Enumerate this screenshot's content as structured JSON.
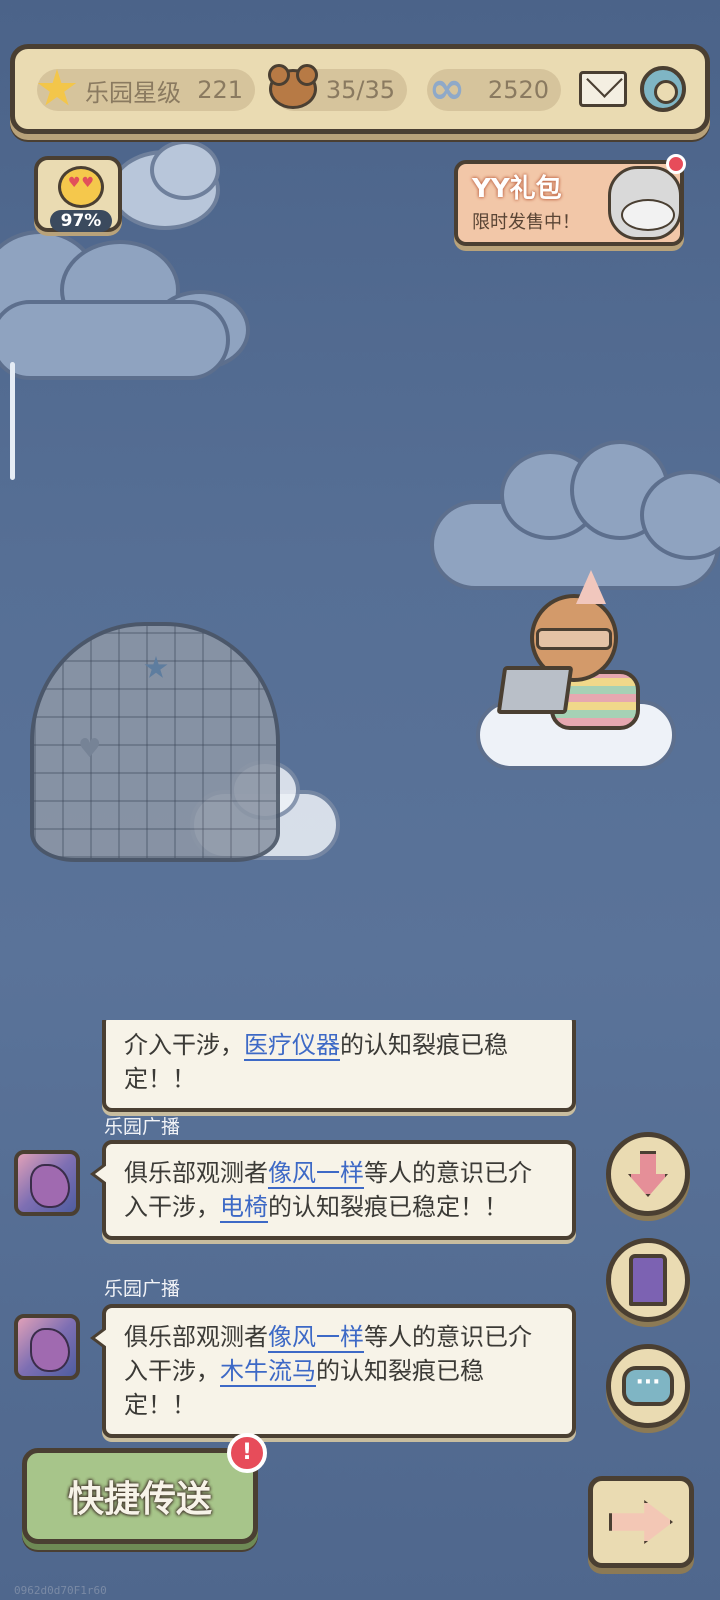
{
  "top_bar": {
    "park_level_label": "乐园星级",
    "park_level_value": "221",
    "bear_count": "35/35",
    "infinity_value": "2520",
    "icons": [
      "star-icon",
      "bear-icon",
      "infinity-icon",
      "mail-icon",
      "gear-icon"
    ]
  },
  "mood": {
    "value": "97%",
    "icon": "heart-eyes-face-icon"
  },
  "gift": {
    "title": "YY礼包",
    "subtitle": "限时发售中！",
    "has_notification": true
  },
  "chat": {
    "messages": [
      {
        "sender": "",
        "text_before": "介入干涉，",
        "link": "医疗仪器",
        "text_after": "的认知裂痕已稳定！！"
      },
      {
        "sender": "乐园广播",
        "text_before": "俱乐部观测者",
        "link": "像风一样",
        "text_middle": "等人的意识已介入干涉，",
        "link2": "电椅",
        "text_after": "的认知裂痕已稳定！！"
      },
      {
        "sender": "乐园广播",
        "text_before": "俱乐部观测者",
        "link": "像风一样",
        "text_middle": "等人的意识已介入干涉，",
        "link2": "木牛流马",
        "text_after": "的认知裂痕已稳定！！"
      }
    ]
  },
  "side_buttons": [
    "arrow-down-icon",
    "door-icon",
    "chat-icon"
  ],
  "chat_icon_text": "···",
  "bottom": {
    "teleport_label": "快捷传送",
    "alert_badge": "!",
    "next_icon": "arrow-right-icon"
  },
  "footer_id": "0962d0d70F1r60",
  "colors": {
    "sky": "#566f95",
    "panel": "#eadbb2",
    "outline": "#4a3f32",
    "link": "#3d69c6",
    "alert": "#e74c5a"
  }
}
